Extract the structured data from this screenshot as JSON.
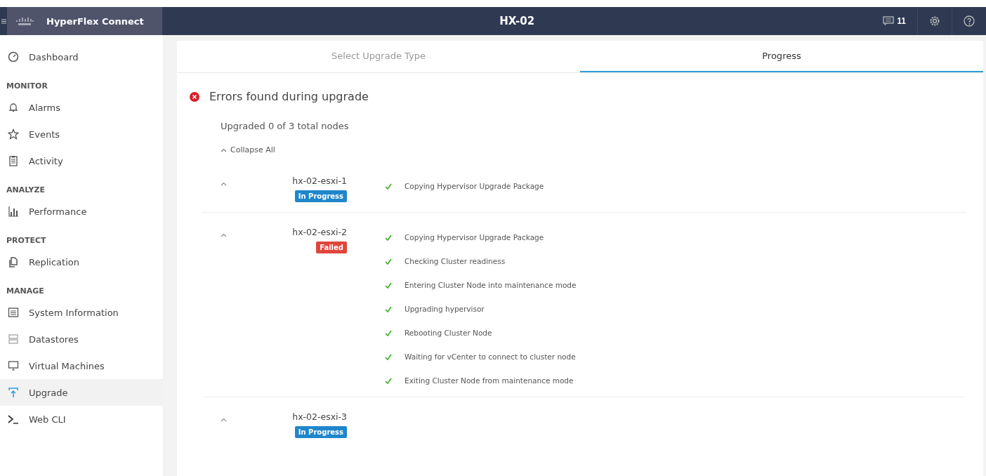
{
  "header": {
    "brand": "HyperFlex Connect",
    "title": "HX-02",
    "notifications": "11"
  },
  "sidebar": {
    "items": [
      {
        "kind": "item",
        "label": "Dashboard",
        "selected": false
      },
      {
        "kind": "section",
        "label": "MONITOR"
      },
      {
        "kind": "item",
        "label": "Alarms",
        "selected": false
      },
      {
        "kind": "item",
        "label": "Events",
        "selected": false
      },
      {
        "kind": "item",
        "label": "Activity",
        "selected": false
      },
      {
        "kind": "section",
        "label": "ANALYZE"
      },
      {
        "kind": "item",
        "label": "Performance",
        "selected": false
      },
      {
        "kind": "section",
        "label": "PROTECT"
      },
      {
        "kind": "item",
        "label": "Replication",
        "selected": false
      },
      {
        "kind": "section",
        "label": "MANAGE"
      },
      {
        "kind": "item",
        "label": "System Information",
        "selected": false
      },
      {
        "kind": "item",
        "label": "Datastores",
        "selected": false
      },
      {
        "kind": "item",
        "label": "Virtual Machines",
        "selected": false
      },
      {
        "kind": "item",
        "label": "Upgrade",
        "selected": true
      },
      {
        "kind": "item",
        "label": "Web CLI",
        "selected": false
      }
    ]
  },
  "tabs": [
    {
      "label": "Select Upgrade Type",
      "selected": false
    },
    {
      "label": "Progress",
      "selected": true
    }
  ],
  "alert": {
    "kind": "error",
    "title": "Errors found during upgrade"
  },
  "summary": "Upgraded 0 of 3 total nodes",
  "collapse_all": "Collapse All",
  "nodes": [
    {
      "name": "hx-02-esxi-1",
      "expanded": true,
      "status": {
        "kind": "in_progress",
        "label": "In Progress"
      },
      "steps": [
        {
          "label": "Copying Hypervisor Upgrade Package",
          "done": true
        }
      ]
    },
    {
      "name": "hx-02-esxi-2",
      "expanded": true,
      "status": {
        "kind": "failed",
        "label": "Failed"
      },
      "steps": [
        {
          "label": "Copying Hypervisor Upgrade Package",
          "done": true
        },
        {
          "label": "Checking Cluster readiness",
          "done": true
        },
        {
          "label": "Entering Cluster Node into maintenance mode",
          "done": true
        },
        {
          "label": "Upgrading hypervisor",
          "done": true
        },
        {
          "label": "Rebooting Cluster Node",
          "done": true
        },
        {
          "label": "Waiting for vCenter to connect to cluster node",
          "done": true
        },
        {
          "label": "Exiting Cluster Node from maintenance mode",
          "done": true
        }
      ]
    },
    {
      "name": "hx-02-esxi-3",
      "expanded": true,
      "status": {
        "kind": "in_progress",
        "label": "In Progress"
      }
    }
  ]
}
